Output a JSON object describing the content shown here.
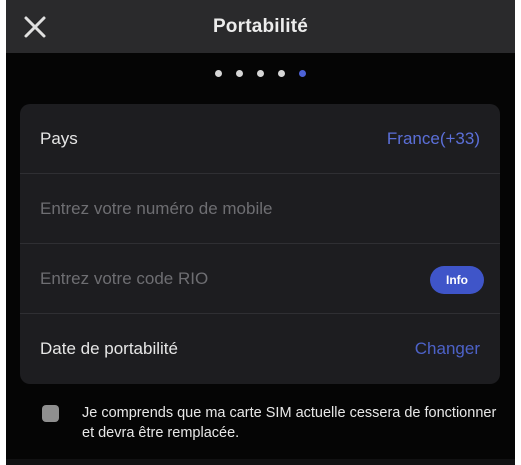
{
  "header": {
    "title": "Portabilité",
    "close_icon": "close-icon"
  },
  "pager": {
    "total": 5,
    "current": 5
  },
  "form": {
    "country": {
      "label": "Pays",
      "value": "France(+33)"
    },
    "mobile": {
      "placeholder": "Entrez votre numéro de mobile",
      "value": ""
    },
    "rio": {
      "placeholder": "Entrez votre code RIO",
      "value": "",
      "info_label": "Info"
    },
    "portability_date": {
      "label": "Date de portabilité",
      "action_label": "Changer"
    }
  },
  "consent": {
    "checked": false,
    "text": "Je comprends que ma carte SIM actuelle cessera de fonctionner et devra être remplacée."
  },
  "colors": {
    "accent": "#4d62d6",
    "background": "#050505",
    "card": "#1d1d20"
  }
}
